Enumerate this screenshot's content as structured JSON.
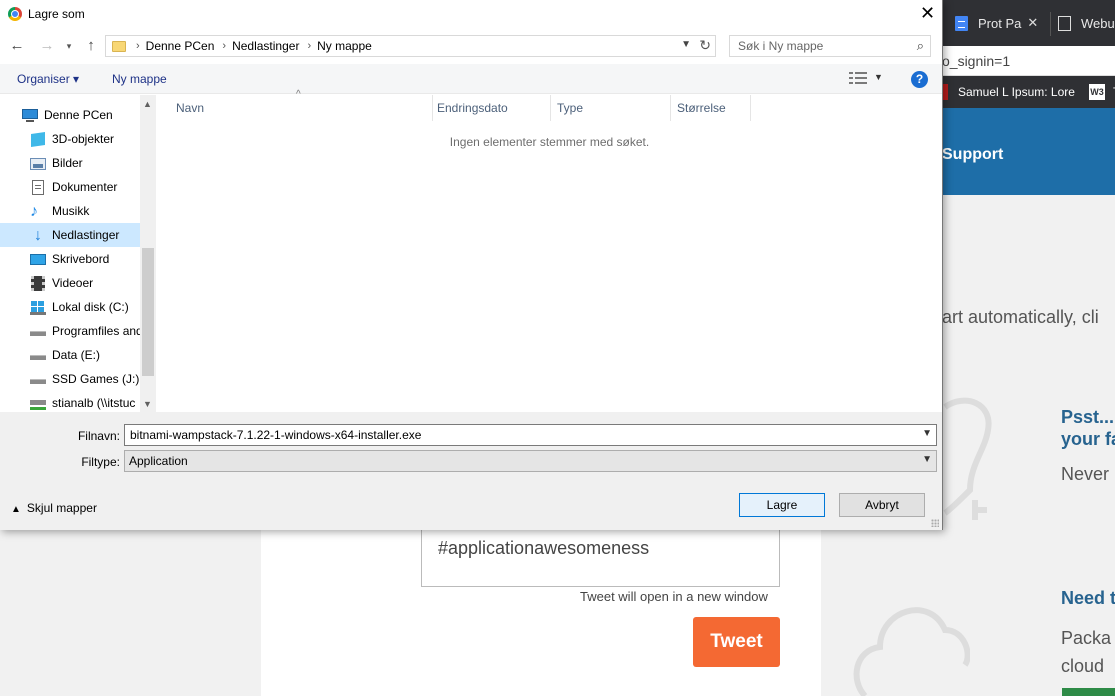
{
  "dialog": {
    "title": "Lagre som",
    "close_label": "✕",
    "breadcrumb": [
      "Denne PCen",
      "Nedlastinger",
      "Ny mappe"
    ],
    "search_placeholder": "Søk i Ny mappe",
    "toolbar": {
      "organize_label": "Organiser ▾",
      "new_folder_label": "Ny mappe",
      "help_label": "?"
    },
    "nav_items": [
      {
        "label": "Denne PCen",
        "icon": "computer-icon"
      },
      {
        "label": "3D-objekter",
        "icon": "3d-objects-icon"
      },
      {
        "label": "Bilder",
        "icon": "pictures-icon"
      },
      {
        "label": "Dokumenter",
        "icon": "documents-icon"
      },
      {
        "label": "Musikk",
        "icon": "music-icon"
      },
      {
        "label": "Nedlastinger",
        "icon": "downloads-icon",
        "selected": true
      },
      {
        "label": "Skrivebord",
        "icon": "desktop-icon"
      },
      {
        "label": "Videoer",
        "icon": "videos-icon"
      },
      {
        "label": "Lokal disk (C:)",
        "icon": "windows-drive-icon"
      },
      {
        "label": "Programfiles and",
        "icon": "drive-icon"
      },
      {
        "label": "Data (E:)",
        "icon": "drive-icon"
      },
      {
        "label": "SSD Games (J:)",
        "icon": "drive-icon"
      },
      {
        "label": "stianalb (\\\\itstuc",
        "icon": "network-drive-icon"
      }
    ],
    "columns": [
      "Navn",
      "Endringsdato",
      "Type",
      "Størrelse"
    ],
    "empty_message": "Ingen elementer stemmer med søket.",
    "filename_label": "Filnavn:",
    "filename_value": "bitnami-wampstack-7.1.22-1-windows-x64-installer.exe",
    "filetype_label": "Filtype:",
    "filetype_value": "Application",
    "hide_folders_label": "Skjul mapper",
    "save_label": "Lagre",
    "cancel_label": "Avbryt"
  },
  "browser": {
    "tabs": [
      {
        "label": "Prot Pa"
      },
      {
        "label": "Webu"
      }
    ],
    "address_fragment": "o_signin=1",
    "bookmark_label": "Samuel L Ipsum: Lore",
    "bookmark_w3": "W3",
    "bookmark_tail": "T",
    "nav_support": "Support",
    "restart_text": "art automatically, cli",
    "psst_text": "Psst...",
    "psst_text2": "your fa",
    "never_text": "Never",
    "tweet_text": "#applicationawesomeness",
    "tweet_note": "Tweet will open in a new window",
    "tweet_button": "Tweet",
    "need_text": "Need t",
    "package_text": "Packa",
    "cloud_text": "cloud"
  },
  "colors": {
    "accent": "#0078d7",
    "tweet": "#f46933",
    "site_header": "#1e6ea8",
    "selected": "#cce8ff"
  }
}
